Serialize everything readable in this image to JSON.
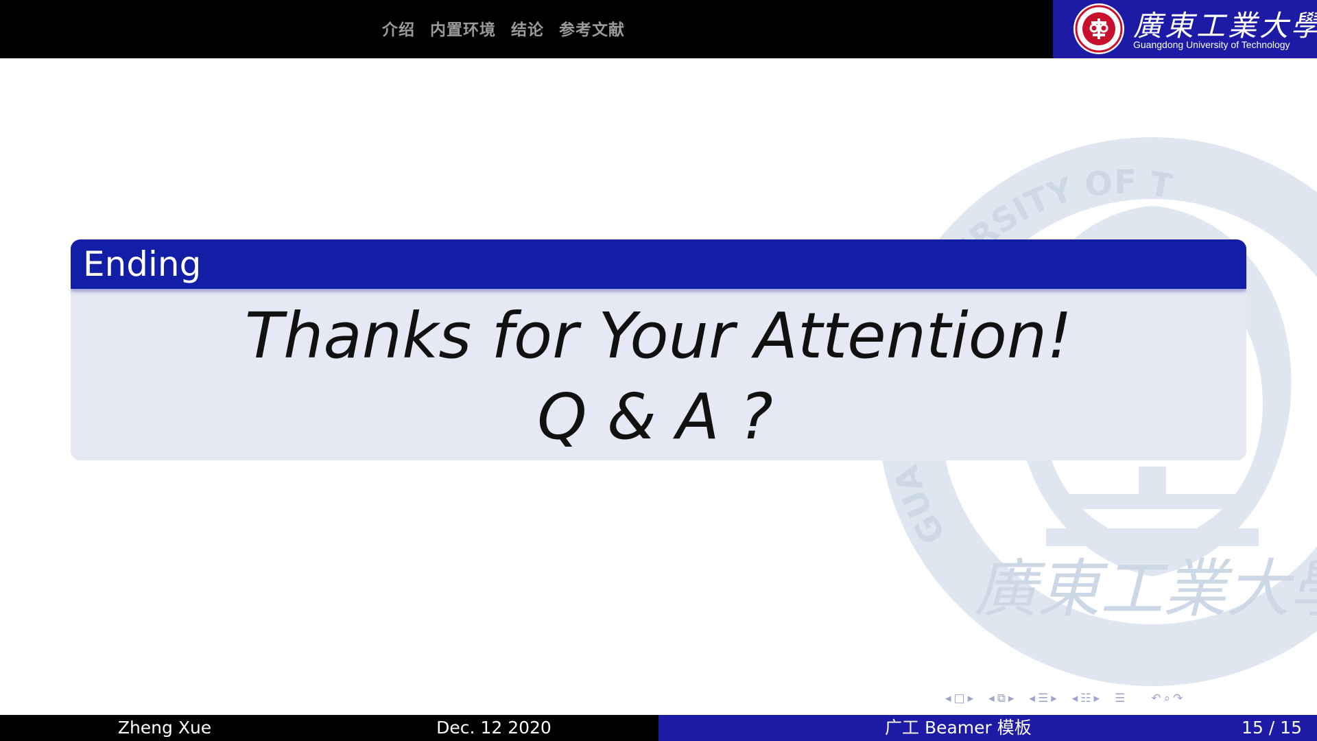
{
  "header": {
    "nav": [
      "介绍",
      "内置环境",
      "结论",
      "参考文献"
    ],
    "logo_cn": "廣東工業大學",
    "logo_en": "Guangdong University of Technology",
    "brand_color": "#1d1aa6"
  },
  "block": {
    "title": "Ending",
    "line1": "Thanks for Your Attention!",
    "line2": "Q & A ?"
  },
  "watermark": {
    "arc_text": "UNIVERSITY OF T",
    "arc_text_left": "GUA",
    "cn": "廣東工業大學"
  },
  "footer": {
    "author": "Zheng Xue",
    "date": "Dec. 12 2020",
    "title": "广工 Beamer 模板",
    "page": "15 / 15"
  },
  "nav_symbols": {
    "icons": [
      "slide-nav-icon",
      "frame-nav-icon",
      "subsection-nav-icon",
      "section-nav-icon",
      "outline-icon",
      "back-icon",
      "search-icon",
      "forward-icon"
    ]
  }
}
